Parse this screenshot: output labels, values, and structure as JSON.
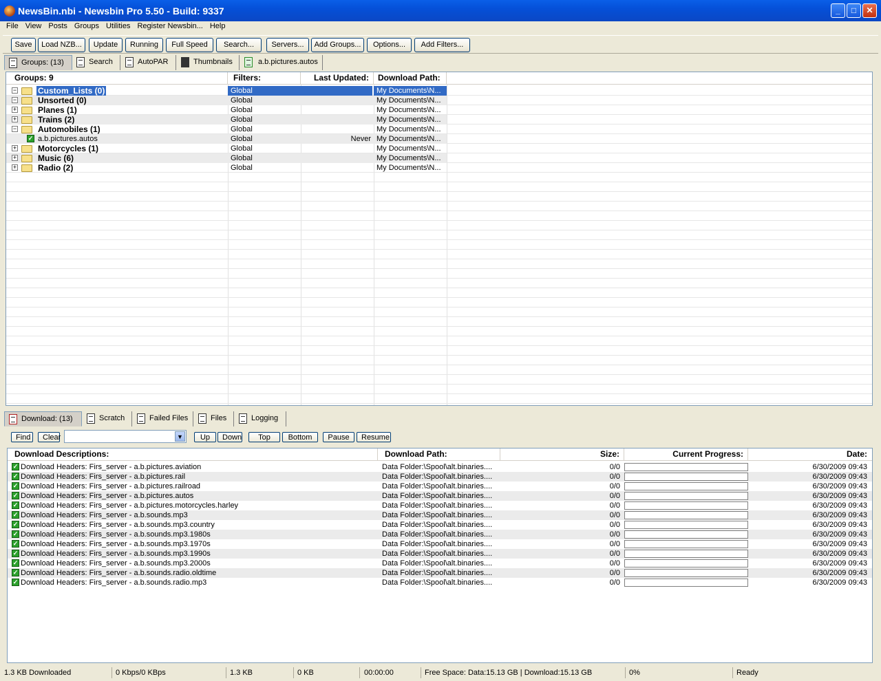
{
  "window": {
    "title": "NewsBin.nbi - Newsbin Pro 5.50 - Build: 9337"
  },
  "menu": [
    "File",
    "View",
    "Posts",
    "Groups",
    "Utilities",
    "Register Newsbin...",
    "Help"
  ],
  "toolbar": [
    "Save",
    "Load NZB...",
    "Update",
    "Running",
    "Full Speed",
    "Search...",
    "Servers...",
    "Add Groups...",
    "Options...",
    "Add Filters..."
  ],
  "top_tabs": [
    "Groups: (13)",
    "Search",
    "AutoPAR",
    "Thumbnails",
    "a.b.pictures.autos"
  ],
  "groups": {
    "headers": [
      "Groups: 9",
      "Filters:",
      "Last Updated:",
      "Download Path:"
    ],
    "rows": [
      {
        "name": "Custom_Lists (0)",
        "filter": "Global",
        "updated": "",
        "path": "My Documents\\N...",
        "kind": "folder",
        "exp": "minus",
        "selected": true
      },
      {
        "name": "Unsorted (0)",
        "filter": "Global",
        "updated": "",
        "path": "My Documents\\N...",
        "kind": "folder",
        "exp": "minus"
      },
      {
        "name": "Planes (1)",
        "filter": "Global",
        "updated": "",
        "path": "My Documents\\N...",
        "kind": "folder",
        "exp": "plus"
      },
      {
        "name": "Trains (2)",
        "filter": "Global",
        "updated": "",
        "path": "My Documents\\N...",
        "kind": "folder",
        "exp": "plus"
      },
      {
        "name": "Automobiles (1)",
        "filter": "Global",
        "updated": "",
        "path": "My Documents\\N...",
        "kind": "folder",
        "exp": "minus"
      },
      {
        "name": "a.b.pictures.autos",
        "filter": "Global",
        "updated": "Never",
        "path": "My Documents\\N...",
        "kind": "group"
      },
      {
        "name": "Motorcycles (1)",
        "filter": "Global",
        "updated": "",
        "path": "My Documents\\N...",
        "kind": "folder",
        "exp": "plus"
      },
      {
        "name": "Music (6)",
        "filter": "Global",
        "updated": "",
        "path": "My Documents\\N...",
        "kind": "folder",
        "exp": "plus"
      },
      {
        "name": "Radio (2)",
        "filter": "Global",
        "updated": "",
        "path": "My Documents\\N...",
        "kind": "folder",
        "exp": "plus"
      }
    ]
  },
  "bottom_tabs": [
    "Download: (13)",
    "Scratch",
    "Failed Files",
    "Files",
    "Logging"
  ],
  "download_buttons": [
    "Find",
    "Clear",
    "Up",
    "Down",
    "Top",
    "Bottom",
    "Pause",
    "Resume"
  ],
  "download": {
    "headers": [
      "Download Descriptions:",
      "Download Path:",
      "Size:",
      "Current Progress:",
      "Date:"
    ],
    "rows": [
      {
        "desc": "Download Headers: Firs_server - a.b.pictures.aviation",
        "path": "Data Folder:\\Spool\\alt.binaries....",
        "size": "0/0",
        "progress": 0,
        "date": "6/30/2009 09:43"
      },
      {
        "desc": "Download Headers: Firs_server - a.b.pictures.rail",
        "path": "Data Folder:\\Spool\\alt.binaries....",
        "size": "0/0",
        "progress": 0,
        "date": "6/30/2009 09:43"
      },
      {
        "desc": "Download Headers: Firs_server - a.b.pictures.railroad",
        "path": "Data Folder:\\Spool\\alt.binaries....",
        "size": "0/0",
        "progress": 0,
        "date": "6/30/2009 09:43"
      },
      {
        "desc": "Download Headers: Firs_server - a.b.pictures.autos",
        "path": "Data Folder:\\Spool\\alt.binaries....",
        "size": "0/0",
        "progress": 0,
        "date": "6/30/2009 09:43"
      },
      {
        "desc": "Download Headers: Firs_server - a.b.pictures.motorcycles.harley",
        "path": "Data Folder:\\Spool\\alt.binaries....",
        "size": "0/0",
        "progress": 0,
        "date": "6/30/2009 09:43"
      },
      {
        "desc": "Download Headers: Firs_server - a.b.sounds.mp3",
        "path": "Data Folder:\\Spool\\alt.binaries....",
        "size": "0/0",
        "progress": 0,
        "date": "6/30/2009 09:43"
      },
      {
        "desc": "Download Headers: Firs_server - a.b.sounds.mp3.country",
        "path": "Data Folder:\\Spool\\alt.binaries....",
        "size": "0/0",
        "progress": 0,
        "date": "6/30/2009 09:43"
      },
      {
        "desc": "Download Headers: Firs_server - a.b.sounds.mp3.1980s",
        "path": "Data Folder:\\Spool\\alt.binaries....",
        "size": "0/0",
        "progress": 0,
        "date": "6/30/2009 09:43"
      },
      {
        "desc": "Download Headers: Firs_server - a.b.sounds.mp3.1970s",
        "path": "Data Folder:\\Spool\\alt.binaries....",
        "size": "0/0",
        "progress": 0,
        "date": "6/30/2009 09:43"
      },
      {
        "desc": "Download Headers: Firs_server - a.b.sounds.mp3.1990s",
        "path": "Data Folder:\\Spool\\alt.binaries....",
        "size": "0/0",
        "progress": 0,
        "date": "6/30/2009 09:43"
      },
      {
        "desc": "Download Headers: Firs_server - a.b.sounds.mp3.2000s",
        "path": "Data Folder:\\Spool\\alt.binaries....",
        "size": "0/0",
        "progress": 0,
        "date": "6/30/2009 09:43"
      },
      {
        "desc": "Download Headers: Firs_server - a.b.sounds.radio.oldtime",
        "path": "Data Folder:\\Spool\\alt.binaries....",
        "size": "0/0",
        "progress": 0,
        "date": "6/30/2009 09:43"
      },
      {
        "desc": "Download Headers: Firs_server - a.b.sounds.radio.mp3",
        "path": "Data Folder:\\Spool\\alt.binaries....",
        "size": "0/0",
        "progress": 0,
        "date": "6/30/2009 09:43"
      }
    ]
  },
  "statusbar": [
    "1.3 KB Downloaded",
    "0 Kbps/0 KBps",
    "1.3 KB",
    "0 KB",
    "00:00:00",
    "Free Space: Data:15.13 GB | Download:15.13 GB",
    "0%",
    "Ready"
  ],
  "colors": {
    "selection": "#316ac5",
    "title_blue": "#0550d8",
    "check_green": "#2ca12c"
  }
}
